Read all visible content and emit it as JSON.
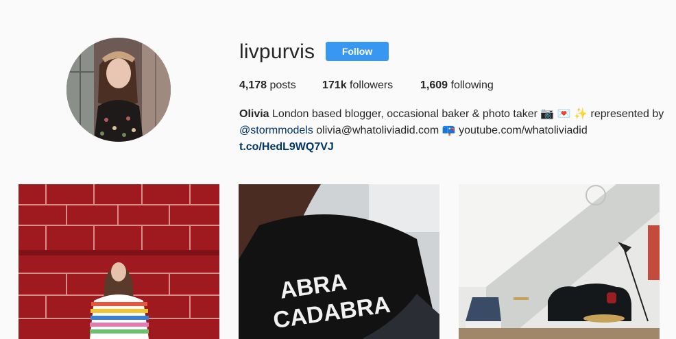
{
  "profile": {
    "username": "livpurvis",
    "follow_label": "Follow",
    "avatar_icon": "profile-photo"
  },
  "stats": {
    "posts_count": "4,178",
    "posts_label": " posts",
    "followers_count": "171k",
    "followers_label": " followers",
    "following_count": "1,609",
    "following_label": " following"
  },
  "bio": {
    "name": "Olivia",
    "line1": " London based blogger, occasional baker & photo taker 📷 💌 ✨ represented by",
    "mention": "@stormmodels",
    "line2": " olivia@whatoliviadid.com 📪 youtube.com/whatoliviadid",
    "link": "t.co/HedL9WQ7VJ"
  },
  "posts": [
    {
      "alt": "woman in striped sweater against red tiled wall"
    },
    {
      "alt": "black sweater reading ABRA CADABRA",
      "sweater_text_1": "ABRA",
      "sweater_text_2": "CADABRA"
    },
    {
      "alt": "interior with black sofa and floor lamp"
    }
  ],
  "colors": {
    "accent": "#3897f0",
    "link": "#003569",
    "background": "#fafafa"
  }
}
